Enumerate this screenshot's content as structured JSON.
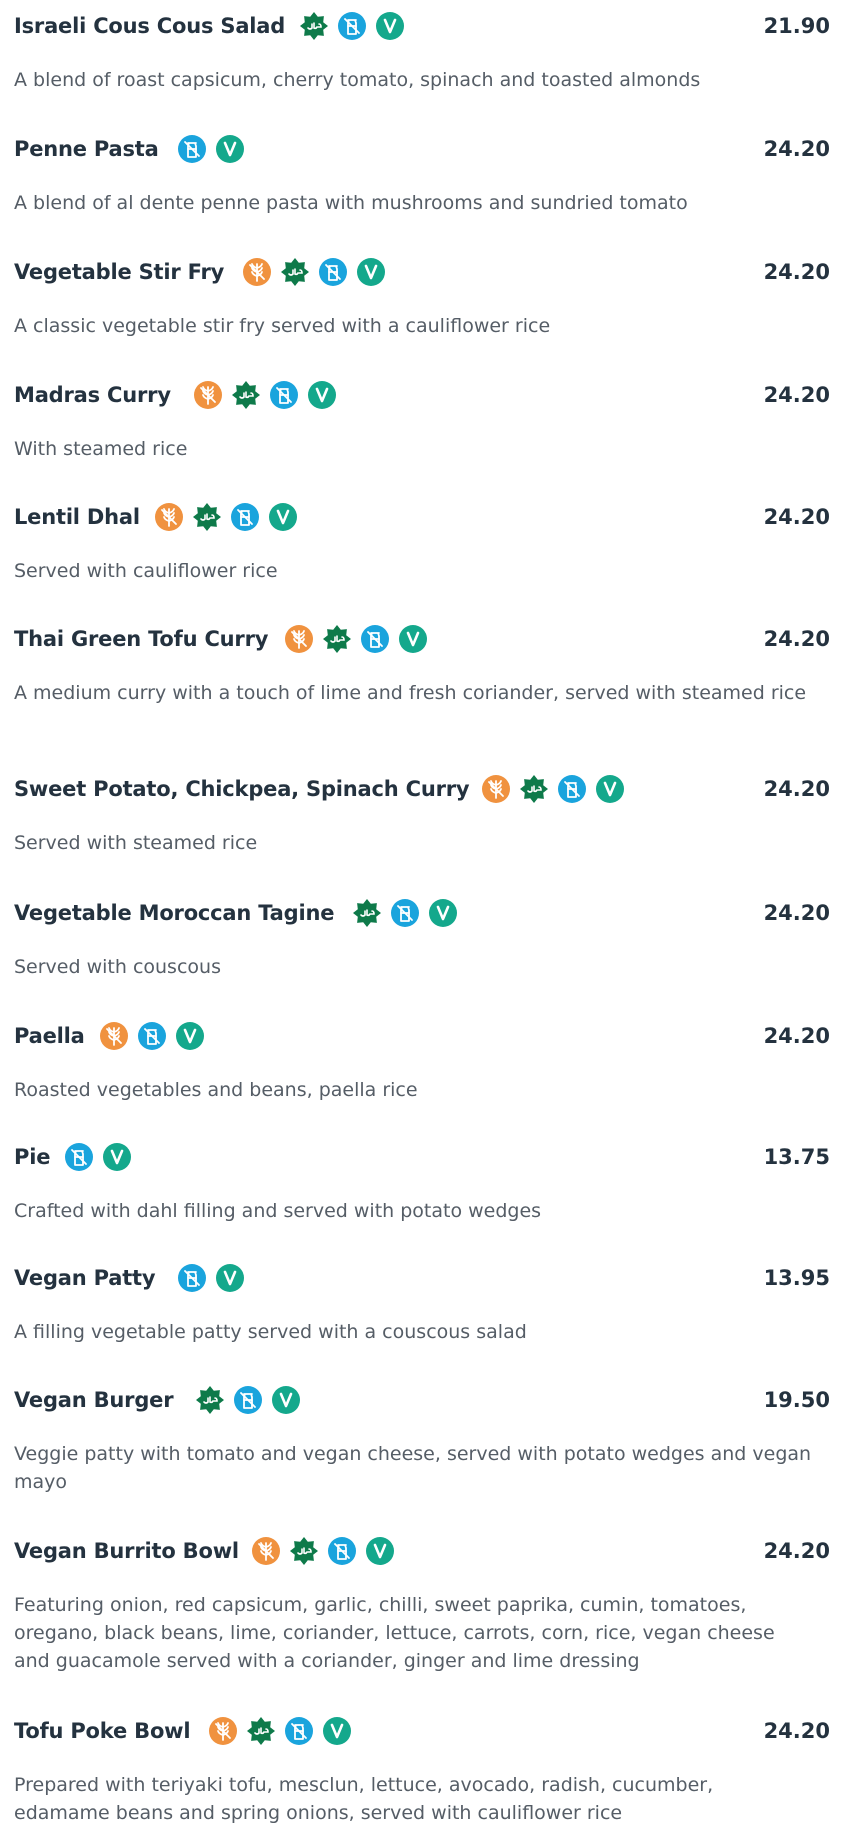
{
  "colors": {
    "gluten_free": "#f0923f",
    "halal": "#0e7a4a",
    "dairy_free": "#1aa4dd",
    "vegan": "#14a88c",
    "title": "#24323f",
    "description": "#555d66"
  },
  "items": [
    {
      "name": "Israeli Cous Cous Salad",
      "price": "21.90",
      "description": "A blend of roast capsicum, cherry tomato, spinach and toasted almonds",
      "icons": [
        "halal-icon",
        "dairy-free-icon",
        "vegan-icon"
      ]
    },
    {
      "name": "Penne Pasta",
      "price": "24.20",
      "description": "A blend of al dente penne pasta with mushrooms and sundried tomato",
      "icons": [
        "dairy-free-icon",
        "vegan-icon"
      ]
    },
    {
      "name": "Vegetable Stir Fry",
      "price": "24.20",
      "description": "A classic vegetable stir fry served with a cauliflower rice",
      "icons": [
        "gluten-free-icon",
        "halal-icon",
        "dairy-free-icon",
        "vegan-icon"
      ]
    },
    {
      "name": "Madras Curry",
      "price": "24.20",
      "description": "With steamed rice",
      "icons": [
        "gluten-free-icon",
        "halal-icon",
        "dairy-free-icon",
        "vegan-icon"
      ]
    },
    {
      "name": "Lentil Dhal",
      "price": "24.20",
      "description": "Served with cauliflower rice",
      "icons": [
        "gluten-free-icon",
        "halal-icon",
        "dairy-free-icon",
        "vegan-icon"
      ]
    },
    {
      "name": "Thai Green Tofu Curry",
      "price": "24.20",
      "description": "A medium curry with a touch of lime and fresh coriander, served with steamed rice",
      "icons": [
        "gluten-free-icon",
        "halal-icon",
        "dairy-free-icon",
        "vegan-icon"
      ]
    },
    {
      "name": "Sweet Potato, Chickpea, Spinach Curry",
      "price": "24.20",
      "description": "Served with steamed rice",
      "icons": [
        "gluten-free-icon",
        "halal-icon",
        "dairy-free-icon",
        "vegan-icon"
      ]
    },
    {
      "name": "Vegetable Moroccan Tagine",
      "price": "24.20",
      "description": "Served with couscous",
      "icons": [
        "halal-icon",
        "dairy-free-icon",
        "vegan-icon"
      ]
    },
    {
      "name": "Paella",
      "price": "24.20",
      "description": "Roasted vegetables and beans, paella rice",
      "icons": [
        "gluten-free-icon",
        "dairy-free-icon",
        "vegan-icon"
      ]
    },
    {
      "name": "Pie",
      "price": "13.75",
      "description": "Crafted with dahl filling and served with potato wedges",
      "icons": [
        "dairy-free-icon",
        "vegan-icon"
      ]
    },
    {
      "name": "Vegan Patty",
      "price": "13.95",
      "description": "A filling vegetable patty served with a couscous salad",
      "icons": [
        "dairy-free-icon",
        "vegan-icon"
      ]
    },
    {
      "name": "Vegan Burger",
      "price": "19.50",
      "description": "Veggie patty with tomato and vegan cheese, served with potato wedges and vegan mayo",
      "icons": [
        "halal-icon",
        "dairy-free-icon",
        "vegan-icon"
      ]
    },
    {
      "name": "Vegan Burrito Bowl",
      "price": "24.20",
      "description": "Featuring onion, red capsicum, garlic, chilli, sweet paprika, cumin, tomatoes, oregano, black beans, lime, coriander, lettuce, carrots, corn, rice, vegan cheese and guacamole served with a coriander, ginger and lime dressing",
      "icons": [
        "gluten-free-icon",
        "halal-icon",
        "dairy-free-icon",
        "vegan-icon"
      ]
    },
    {
      "name": "Tofu Poke Bowl",
      "price": "24.20",
      "description": "Prepared with teriyaki tofu, mesclun, lettuce, avocado, radish, cucumber, edamame beans and spring onions, served with cauliflower rice",
      "icons": [
        "gluten-free-icon",
        "halal-icon",
        "dairy-free-icon",
        "vegan-icon"
      ]
    }
  ]
}
